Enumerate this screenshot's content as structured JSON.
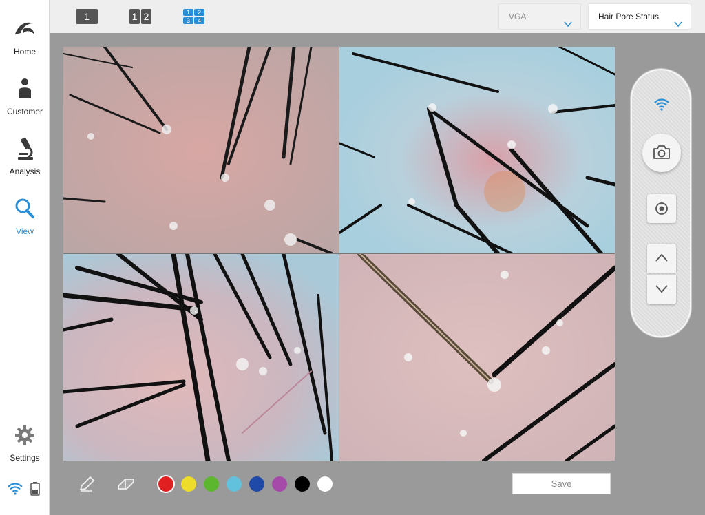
{
  "sidebar": {
    "items": [
      {
        "label": "Home",
        "icon": "logo-icon"
      },
      {
        "label": "Customer",
        "icon": "person-icon"
      },
      {
        "label": "Analysis",
        "icon": "microscope-icon"
      },
      {
        "label": "View",
        "icon": "search-icon",
        "active": true
      },
      {
        "label": "Settings",
        "icon": "gear-icon"
      }
    ],
    "status": {
      "wifi": "wifi-icon",
      "battery": "battery-icon"
    }
  },
  "topbar": {
    "layouts": [
      {
        "name": "single",
        "labels": [
          "1"
        ]
      },
      {
        "name": "dual",
        "labels": [
          "1",
          "2"
        ]
      },
      {
        "name": "quad",
        "labels": [
          "1",
          "2",
          "3",
          "4"
        ],
        "active": true
      }
    ],
    "resolution": "VGA",
    "mode": "Hair Pore Status"
  },
  "colors": {
    "accent": "#2a8fd6",
    "palette": [
      "#e02020",
      "#eedc2a",
      "#5cb62e",
      "#62c2dd",
      "#1f4aa8",
      "#a54aa8",
      "#000000",
      "#ffffff"
    ],
    "selected_color_index": 0
  },
  "panel": {
    "wifi": "wifi-icon",
    "capture": "camera-icon",
    "record": "record-icon",
    "up": "chevron-up-icon",
    "down": "chevron-down-icon"
  },
  "toolbar": {
    "tools": [
      "pen-icon",
      "eraser-icon"
    ],
    "save_label": "Save"
  }
}
